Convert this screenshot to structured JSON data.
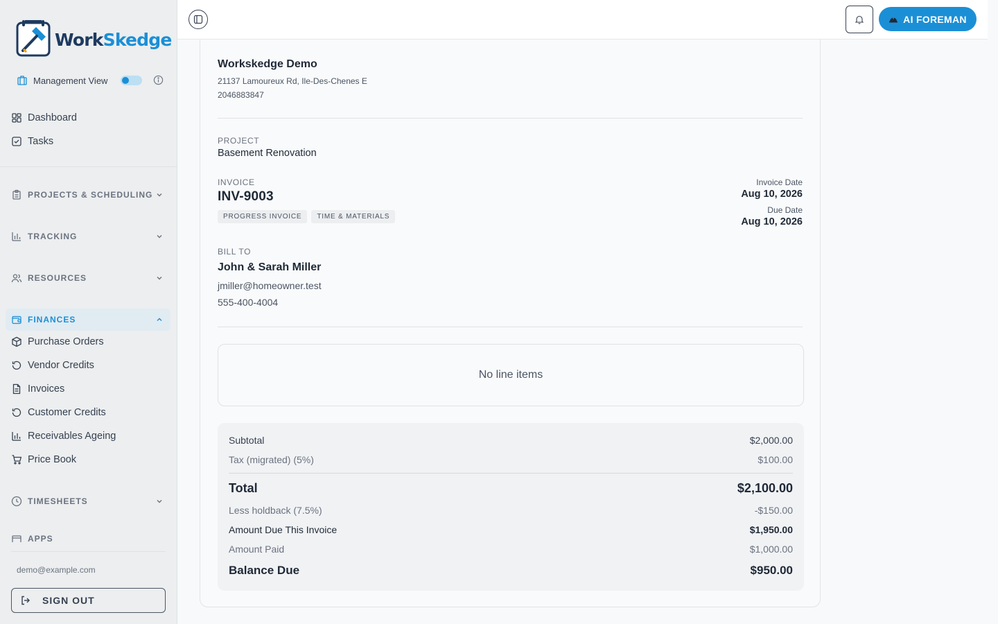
{
  "brand": {
    "name_part1": "Work",
    "name_part2": "Skedge",
    "accent": "#1b8fd6",
    "dark": "#1e3a5f"
  },
  "sidebar": {
    "management_view_label": "Management View",
    "management_view_on": true,
    "top_items": [
      {
        "label": "Dashboard",
        "icon": "dashboard-icon"
      },
      {
        "label": "Tasks",
        "icon": "checkbox-icon"
      }
    ],
    "sections": {
      "projects": "PROJECTS & SCHEDULING",
      "tracking": "TRACKING",
      "resources": "RESOURCES",
      "finances": "FINANCES",
      "timesheets": "TIMESHEETS",
      "apps": "APPS"
    },
    "finance_items": [
      {
        "label": "Purchase Orders",
        "icon": "box-icon"
      },
      {
        "label": "Vendor Credits",
        "icon": "refresh-icon"
      },
      {
        "label": "Invoices",
        "icon": "document-icon"
      },
      {
        "label": "Customer Credits",
        "icon": "refresh-icon"
      },
      {
        "label": "Receivables Ageing",
        "icon": "bar-chart-icon"
      },
      {
        "label": "Price Book",
        "icon": "cart-icon"
      }
    ],
    "user_email": "demo@example.com",
    "signout_label": "SIGN OUT"
  },
  "header": {
    "ai_button_label": "AI FOREMAN"
  },
  "invoice": {
    "company_name": "Workskedge Demo",
    "company_address": "21137 Lamoureux Rd, Ile-Des-Chenes E",
    "company_phone": "2046883847",
    "project_label": "PROJECT",
    "project_name": "Basement Renovation",
    "invoice_label": "INVOICE",
    "invoice_number": "INV-9003",
    "tags": [
      "PROGRESS INVOICE",
      "TIME & MATERIALS"
    ],
    "invoice_date_label": "Invoice Date",
    "invoice_date": "Aug 10, 2026",
    "due_date_label": "Due Date",
    "due_date": "Aug 10, 2026",
    "bill_to_label": "BILL TO",
    "bill_to_name": "John & Sarah Miller",
    "bill_to_email": "jmiller@homeowner.test",
    "bill_to_phone": "555-400-4004",
    "empty_line_items": "No line items",
    "totals": {
      "subtotal_label": "Subtotal",
      "subtotal": "$2,000.00",
      "tax_label": "Tax (migrated) (5%)",
      "tax": "$100.00",
      "total_label": "Total",
      "total": "$2,100.00",
      "holdback_label": "Less holdback (7.5%)",
      "holdback": "-$150.00",
      "amount_due_label": "Amount Due This Invoice",
      "amount_due": "$1,950.00",
      "amount_paid_label": "Amount Paid",
      "amount_paid": "$1,000.00",
      "balance_label": "Balance Due",
      "balance": "$950.00"
    }
  }
}
